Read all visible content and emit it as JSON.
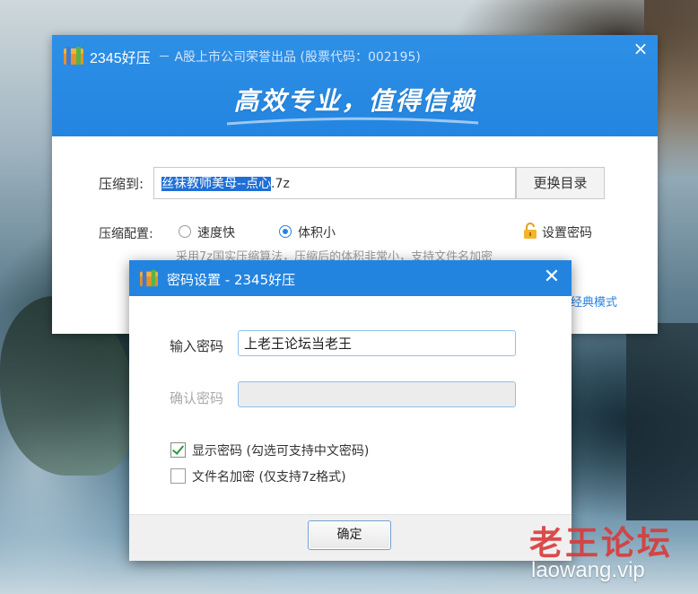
{
  "main_window": {
    "app_name": "2345好压",
    "subtitle": "－ A股上市公司荣誉出品 (股票代码：002195)",
    "slogan": "高效专业，值得信赖",
    "close_icon": "×",
    "compress_to_label": "压缩到:",
    "path_selected": "丝袜教师美母--点心",
    "path_rest": ".7z",
    "change_dir_label": "更换目录",
    "config_label": "压缩配置:",
    "options": [
      {
        "label": "速度快",
        "checked": false
      },
      {
        "label": "体积小",
        "checked": true
      }
    ],
    "set_password_label": "设置密码",
    "algo_desc": "采用7z国实压缩算法，压缩后的体积非常小，支持文件名加密",
    "classic_mode_label": "经典模式"
  },
  "password_dialog": {
    "title": "密码设置 - 2345好压",
    "close_icon": "✕",
    "password_label": "输入密码",
    "password_value": "上老王论坛当老王",
    "confirm_label": "确认密码",
    "confirm_value": "",
    "checkboxes": [
      {
        "label": "显示密码 (勾选可支持中文密码)",
        "checked": true
      },
      {
        "label": "文件名加密  (仅支持7z格式)",
        "checked": false
      }
    ],
    "ok_label": "确定"
  },
  "watermark": {
    "title": "老王论坛",
    "url": "laowang.vip"
  },
  "colors": {
    "header_blue": "#2385e0",
    "accent": "#2a83e0",
    "watermark_red": "#d93a3a"
  },
  "icons": [
    "app-logo-icon",
    "close-icon",
    "lock-icon",
    "checkmark-icon"
  ]
}
